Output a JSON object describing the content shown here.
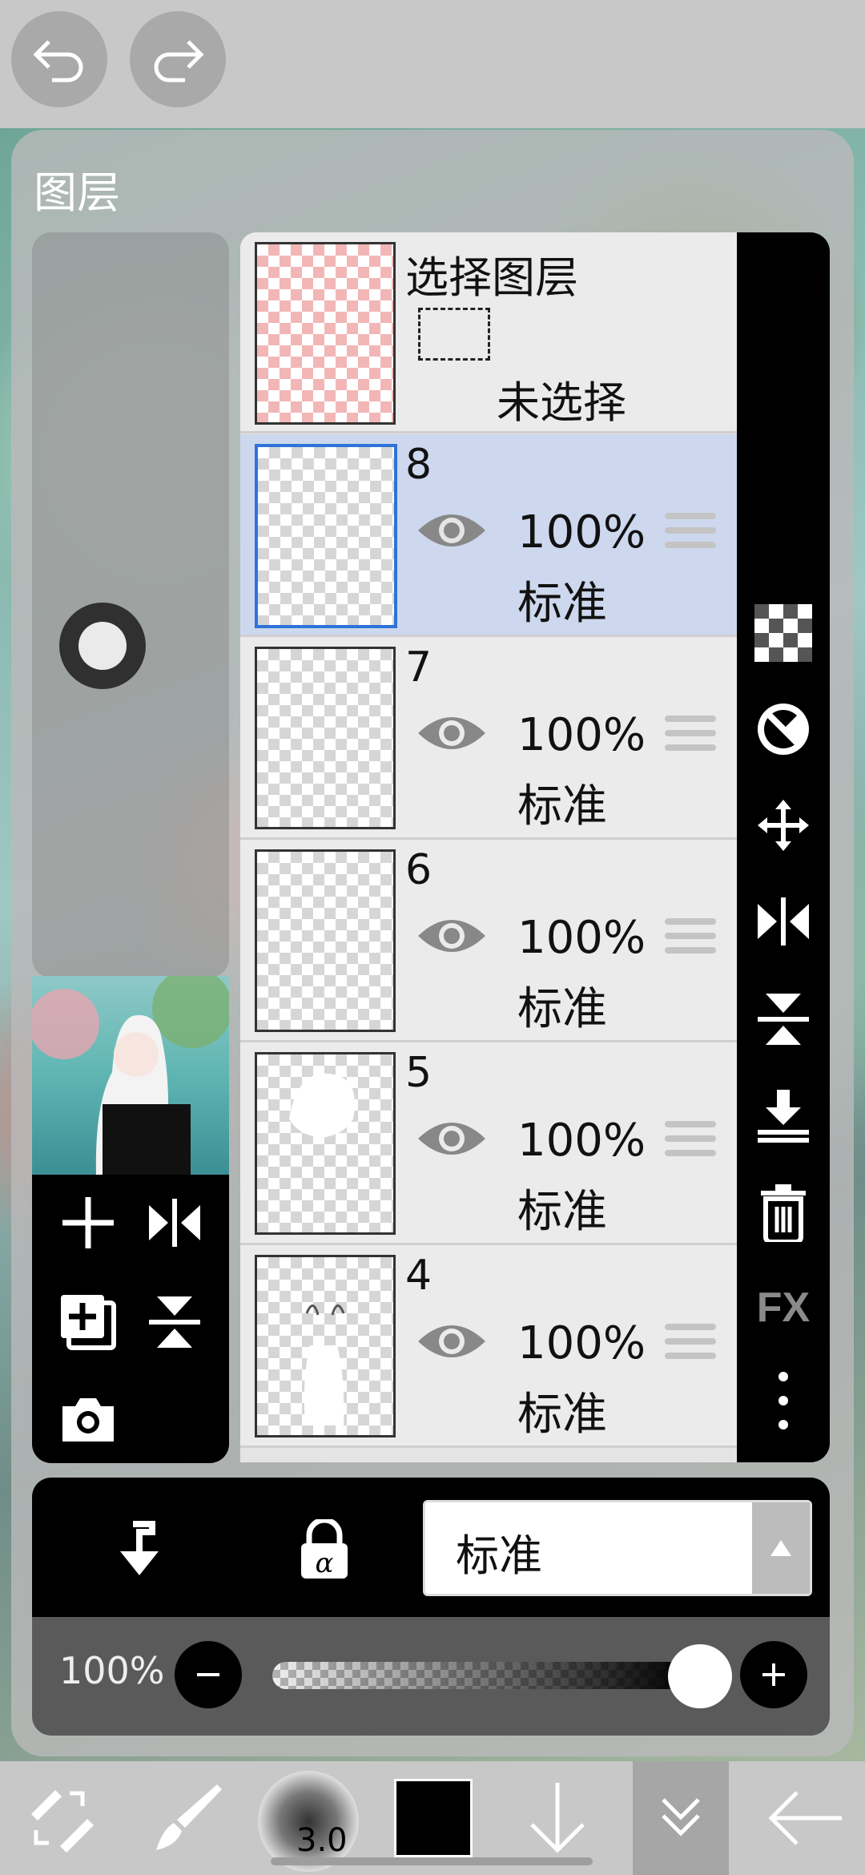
{
  "top_toolbar": {
    "undo": "undo-icon",
    "redo": "redo-icon"
  },
  "panel": {
    "title": "图层"
  },
  "selection_layer": {
    "title": "选择图层",
    "status": "未选择"
  },
  "layers": [
    {
      "name": "8",
      "opacity": "100%",
      "blend": "标准",
      "selected": true
    },
    {
      "name": "7",
      "opacity": "100%",
      "blend": "标准",
      "selected": false
    },
    {
      "name": "6",
      "opacity": "100%",
      "blend": "标准",
      "selected": false
    },
    {
      "name": "5",
      "opacity": "100%",
      "blend": "标准",
      "selected": false
    },
    {
      "name": "4",
      "opacity": "100%",
      "blend": "标准",
      "selected": false
    }
  ],
  "right_tools": [
    "checker-icon",
    "half-circle-icon",
    "move-icon",
    "flip-horizontal-icon",
    "flip-vertical-icon",
    "merge-down-icon",
    "trash-icon",
    "fx-icon",
    "more-icon"
  ],
  "right_fx_label": "FX",
  "left_tools": [
    "add-layer-icon",
    "flip-h-icon",
    "duplicate-icon",
    "flip-v-icon",
    "camera-icon"
  ],
  "blend_mode": {
    "current": "标准"
  },
  "opacity": {
    "label": "100%",
    "value": 100
  },
  "bottom_toolbar": {
    "brush_size": "3.0",
    "color": "#000000"
  }
}
